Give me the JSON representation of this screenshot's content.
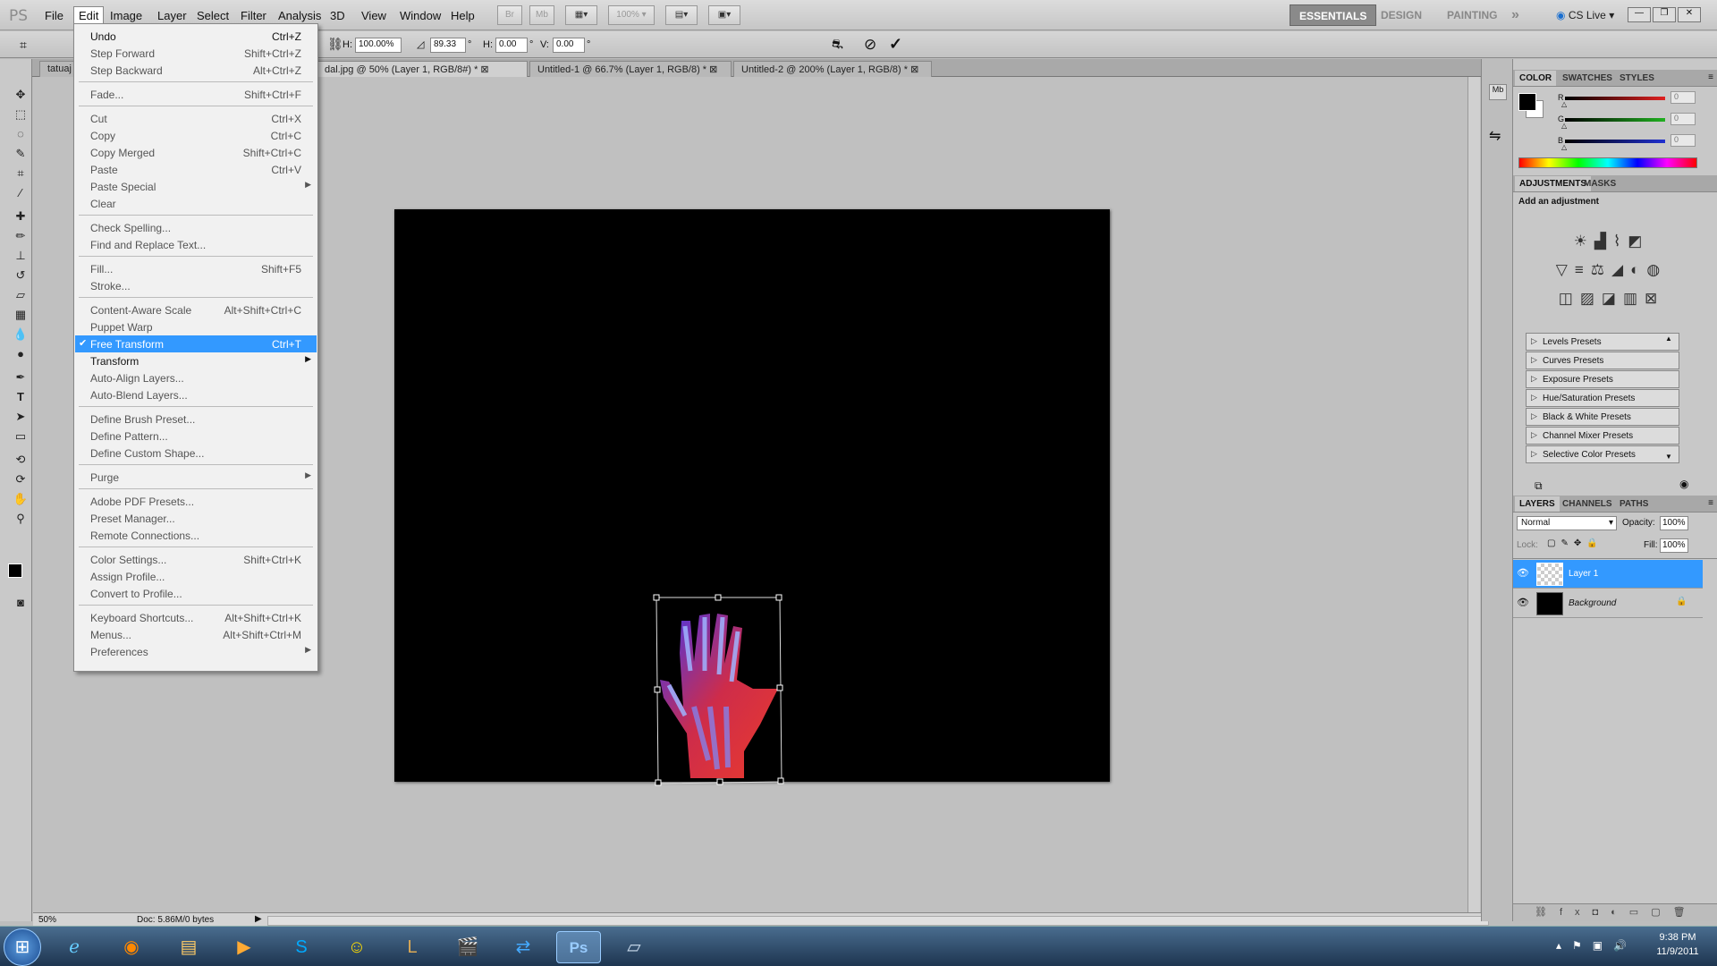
{
  "app": {
    "logo": "PS"
  },
  "menubar": {
    "items": [
      "File",
      "Edit",
      "Image",
      "Layer",
      "Select",
      "Filter",
      "Analysis",
      "3D",
      "View",
      "Window",
      "Help"
    ],
    "toolbar_buttons": [
      "Br",
      "Mb"
    ],
    "zoom_value": "100%",
    "workspaces": [
      "ESSENTIALS",
      "DESIGN",
      "PAINTING"
    ],
    "more": "»",
    "cs_live": "CS Live"
  },
  "options": {
    "h_label": "H:",
    "h_value": "100.00%",
    "angle_value": "89.33",
    "angle_unit": "°",
    "hskew_label": "H:",
    "hskew_value": "0.00",
    "vskew_label": "V:",
    "vskew_value": "0.00",
    "deg": "°"
  },
  "tabs": [
    {
      "label": "tatuaj",
      "active": false
    },
    {
      "label": "dal.jpg @ 50% (Layer 1, RGB/8#) *",
      "active": true
    },
    {
      "label": "Untitled-1 @ 66.7% (Layer 1, RGB/8) *",
      "active": false
    },
    {
      "label": "Untitled-2 @ 200% (Layer 1, RGB/8) *",
      "active": false
    }
  ],
  "status": {
    "zoom": "50%",
    "doc": "Doc: 5.86M/0 bytes"
  },
  "edit_menu": [
    {
      "label": "Undo",
      "shortcut": "Ctrl+Z",
      "enabled": true
    },
    {
      "label": "Step Forward",
      "shortcut": "Shift+Ctrl+Z",
      "enabled": false
    },
    {
      "label": "Step Backward",
      "shortcut": "Alt+Ctrl+Z",
      "enabled": false
    },
    {
      "sep": true
    },
    {
      "label": "Fade...",
      "shortcut": "Shift+Ctrl+F",
      "enabled": false
    },
    {
      "sep": true
    },
    {
      "label": "Cut",
      "shortcut": "Ctrl+X",
      "enabled": false
    },
    {
      "label": "Copy",
      "shortcut": "Ctrl+C",
      "enabled": false
    },
    {
      "label": "Copy Merged",
      "shortcut": "Shift+Ctrl+C",
      "enabled": false
    },
    {
      "label": "Paste",
      "shortcut": "Ctrl+V",
      "enabled": false
    },
    {
      "label": "Paste Special",
      "shortcut": "",
      "submenu": true,
      "enabled": false
    },
    {
      "label": "Clear",
      "shortcut": "",
      "enabled": false
    },
    {
      "sep": true
    },
    {
      "label": "Check Spelling...",
      "shortcut": "",
      "enabled": false
    },
    {
      "label": "Find and Replace Text...",
      "shortcut": "",
      "enabled": false
    },
    {
      "sep": true
    },
    {
      "label": "Fill...",
      "shortcut": "Shift+F5",
      "enabled": false
    },
    {
      "label": "Stroke...",
      "shortcut": "",
      "enabled": false
    },
    {
      "sep": true
    },
    {
      "label": "Content-Aware Scale",
      "shortcut": "Alt+Shift+Ctrl+C",
      "enabled": false
    },
    {
      "label": "Puppet Warp",
      "shortcut": "",
      "enabled": false
    },
    {
      "label": "Free Transform",
      "shortcut": "Ctrl+T",
      "enabled": true,
      "highlight": true,
      "checked": true
    },
    {
      "label": "Transform",
      "shortcut": "",
      "submenu": true,
      "enabled": true
    },
    {
      "label": "Auto-Align Layers...",
      "shortcut": "",
      "enabled": false
    },
    {
      "label": "Auto-Blend Layers...",
      "shortcut": "",
      "enabled": false
    },
    {
      "sep": true
    },
    {
      "label": "Define Brush Preset...",
      "shortcut": "",
      "enabled": false
    },
    {
      "label": "Define Pattern...",
      "shortcut": "",
      "enabled": false
    },
    {
      "label": "Define Custom Shape...",
      "shortcut": "",
      "enabled": false
    },
    {
      "sep": true
    },
    {
      "label": "Purge",
      "shortcut": "",
      "submenu": true,
      "enabled": false
    },
    {
      "sep": true
    },
    {
      "label": "Adobe PDF Presets...",
      "shortcut": "",
      "enabled": false
    },
    {
      "label": "Preset Manager...",
      "shortcut": "",
      "enabled": false
    },
    {
      "label": "Remote Connections...",
      "shortcut": "",
      "enabled": false
    },
    {
      "sep": true
    },
    {
      "label": "Color Settings...",
      "shortcut": "Shift+Ctrl+K",
      "enabled": false
    },
    {
      "label": "Assign Profile...",
      "shortcut": "",
      "enabled": false
    },
    {
      "label": "Convert to Profile...",
      "shortcut": "",
      "enabled": false
    },
    {
      "sep": true
    },
    {
      "label": "Keyboard Shortcuts...",
      "shortcut": "Alt+Shift+Ctrl+K",
      "enabled": false
    },
    {
      "label": "Menus...",
      "shortcut": "Alt+Shift+Ctrl+M",
      "enabled": false
    },
    {
      "label": "Preferences",
      "shortcut": "",
      "submenu": true,
      "enabled": false
    }
  ],
  "color_panel": {
    "tabs": [
      "COLOR",
      "SWATCHES",
      "STYLES"
    ],
    "channels": [
      {
        "label": "R",
        "value": "0",
        "color": "#e02020"
      },
      {
        "label": "G",
        "value": "0",
        "color": "#20b020"
      },
      {
        "label": "B",
        "value": "0",
        "color": "#2030d0"
      }
    ]
  },
  "adjustments_panel": {
    "tabs": [
      "ADJUSTMENTS",
      "MASKS"
    ],
    "title": "Add an adjustment",
    "presets": [
      "Levels Presets",
      "Curves Presets",
      "Exposure Presets",
      "Hue/Saturation Presets",
      "Black & White Presets",
      "Channel Mixer Presets",
      "Selective Color Presets"
    ]
  },
  "layers_panel": {
    "tabs": [
      "LAYERS",
      "CHANNELS",
      "PATHS"
    ],
    "blend_mode": "Normal",
    "opacity_label": "Opacity:",
    "opacity_value": "100%",
    "lock_label": "Lock:",
    "fill_label": "Fill:",
    "fill_value": "100%",
    "layers": [
      {
        "name": "Layer 1",
        "selected": true
      },
      {
        "name": "Background",
        "selected": false
      }
    ]
  },
  "taskbar": {
    "icons": [
      "windows-start-icon",
      "internet-explorer-icon",
      "firefox-icon",
      "file-explorer-icon",
      "media-player-icon",
      "skype-icon",
      "yahoo-messenger-icon",
      "league-of-legends-icon",
      "clapperboard-icon",
      "teamviewer-icon",
      "photoshop-icon",
      "notes-icon"
    ],
    "time": "9:38 PM",
    "date": "11/9/2011"
  }
}
